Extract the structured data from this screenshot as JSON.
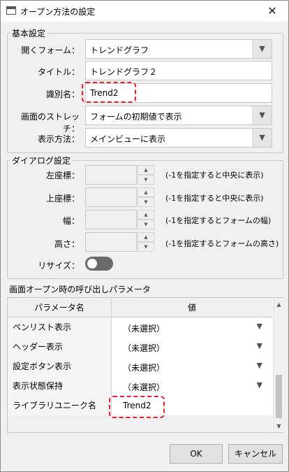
{
  "window": {
    "title": "オープン方法の設定",
    "close_glyph": "✕"
  },
  "basic": {
    "legend": "基本設定",
    "open_form_label": "開くフォーム：",
    "open_form_value": "トレンドグラフ",
    "title_label": "タイトル：",
    "title_value": "トレンドグラフ２",
    "id_label": "識別名：",
    "id_value": "Trend2",
    "stretch_label": "画面のストレッチ：",
    "stretch_value": "フォームの初期値で表示",
    "display_label": "表示方法：",
    "display_value": "メインビューに表示"
  },
  "dialog": {
    "legend": "ダイアログ設定",
    "left_label": "左座標：",
    "left_hint": "(-1を指定すると中央に表示)",
    "top_label": "上座標：",
    "top_hint": "(-1を指定すると中央に表示)",
    "width_label": "幅：",
    "width_hint": "(-1を指定するとフォームの幅)",
    "height_label": "高さ：",
    "height_hint": "(-1を指定するとフォームの高さ)",
    "resize_label": "リサイズ：",
    "resize_on": false
  },
  "params": {
    "section_title": "画面オープン時の呼び出しパラメータ",
    "col_name": "パラメータ名",
    "col_value": "値",
    "rows": [
      {
        "name": "ペンリスト表示",
        "value": "（未選択）"
      },
      {
        "name": "ヘッダー表示",
        "value": "（未選択）"
      },
      {
        "name": "設定ボタン表示",
        "value": "（未選択）"
      },
      {
        "name": "表示状態保持",
        "value": "（未選択）"
      },
      {
        "name": "ライブラリユニーク名",
        "value": "Trend2"
      }
    ]
  },
  "buttons": {
    "ok": "OK",
    "cancel": "キャンセル"
  },
  "icons": {
    "dropdown": "▼",
    "spin_up": "▲",
    "spin_down": "▼",
    "scroll_up": "▲",
    "scroll_down": "▼"
  },
  "colors": {
    "highlight": "#e8202a"
  }
}
